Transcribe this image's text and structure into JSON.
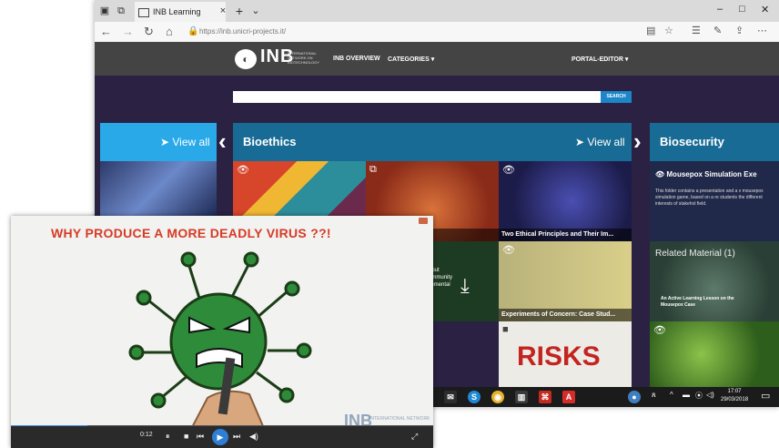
{
  "browser": {
    "tab_title": "INB Learning Library",
    "url": "https://inb.unicri-projects.it/",
    "new_tab": "+",
    "tab_close": "×",
    "controls": {
      "minimize": "–",
      "maximize": "□",
      "close": "✕"
    }
  },
  "site": {
    "logo_text": "INB",
    "logo_subtitle": "INTERNATIONAL NETWORK ON BIOTECHNOLOGY",
    "nav": {
      "overview": "INB OVERVIEW",
      "categories": "CATEGORIES ▾",
      "portal_editor": "PORTAL-EDITOR ▾"
    },
    "search": {
      "placeholder": "",
      "button": "SEARCH"
    },
    "left_panel": {
      "view_all": "View all"
    },
    "bioethics": {
      "title": "Bioethics",
      "view_all": "View all",
      "tiles": [
        {
          "label": "ual-Use Research"
        },
        {
          "label": "Two Ethical Principles and Their Im..."
        },
        {
          "label": "Experiments of Concern: Case Stud..."
        },
        {
          "label": "RISKS"
        }
      ],
      "snippet": [
        "ithout",
        "community",
        "ronmental"
      ]
    },
    "biosecurity": {
      "title": "Biosecurity",
      "item_title": "Mousepox Simulation Exe",
      "item_text": "This folder contains a presentation and a v mousepox simulation game, based on a re students the different interests of stakehol field.",
      "related": "Related Material (1)",
      "related_item": "An Active Learning Lesson on the Mousepox Case"
    }
  },
  "taskbar": {
    "time": "17:07",
    "date": "29/03/2018"
  },
  "video": {
    "title": "WHY PRODUCE A MORE DEADLY VIRUS ??!",
    "watermark": "INB",
    "watermark_sub": "INTERNATIONAL NETWORK",
    "progress": 0.18,
    "time_label": "0:12"
  }
}
